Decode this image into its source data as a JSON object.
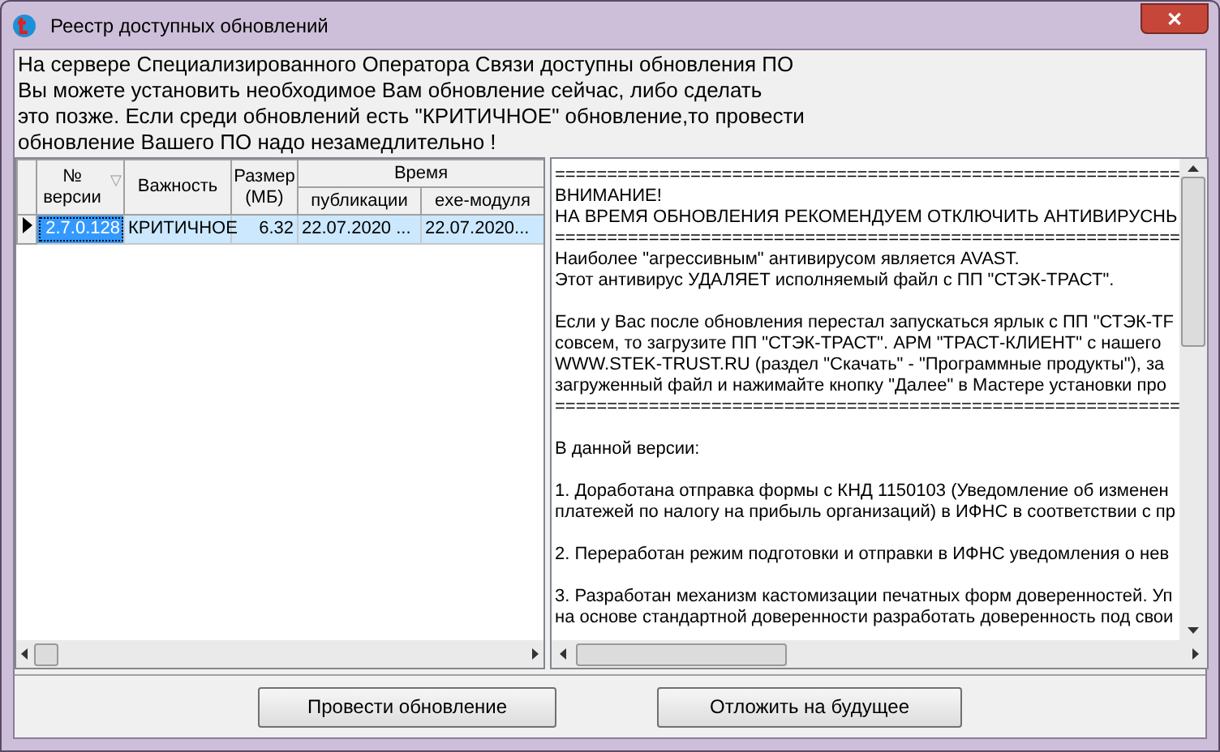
{
  "window": {
    "title": "Реестр доступных обновлений",
    "close_label": "✕"
  },
  "intro_lines": [
    "На сервере Специализированного Оператора Связи доступны обновления ПО",
    "Вы можете установить необходимое Вам обновление сейчас, либо сделать",
    "это позже. Если среди обновлений есть \"КРИТИЧНОЕ\"  обновление,то провести",
    "обновление Вашего ПО надо незамедлительно !"
  ],
  "table": {
    "header_rows": [
      [
        {
          "label": "№ версии",
          "sort_mark": "▽",
          "spans_both_rows": true
        },
        {
          "label": "Важность",
          "spans_both_rows": true
        },
        {
          "label": "Размер (МБ)",
          "spans_both_rows": true
        },
        {
          "label": "Время",
          "spans_two_columns": true
        }
      ],
      [
        {
          "label": "публикации"
        },
        {
          "label": "exe-модуля"
        }
      ]
    ],
    "rows": [
      {
        "selected": true,
        "cells": [
          "2.7.0.128",
          "КРИТИЧНОЕ",
          "6.32",
          "22.07.2020 ...",
          "22.07.2020..."
        ]
      }
    ]
  },
  "notes": [
    [
      "============================================================",
      "ВНИМАНИЕ!",
      "НА ВРЕМЯ ОБНОВЛЕНИЯ РЕКОМЕНДУЕМ ОТКЛЮЧИТЬ АНТИВИРУСНЬ",
      "============================================================",
      "Наиболее \"агрессивным\" антивирусом является AVAST.",
      "Этот антивирус УДАЛЯЕТ исполняемый файл с ПП \"СТЭК-ТРАСТ\"."
    ],
    [
      "Если у Вас после обновления перестал запускаться ярлык с ПП \"СТЭК-ТF",
      "совсем, то загрузите ПП \"СТЭК-ТРАСТ\". АРМ \"ТРАСТ-КЛИЕНТ\" с нашего",
      "WWW.STEK-TRUST.RU (раздел \"Скачать\" - \"Программные продукты\"), за",
      "загруженный файл и нажимайте кнопку \"Далее\" в Мастере установки про",
      "============================================================"
    ],
    [
      "В данной версии:"
    ],
    [
      "1. Доработана отправка формы с КНД 1150103 (Уведомление об изменен",
      "платежей по налогу на прибыль организаций) в ИФНС в соответствии с пр"
    ],
    [
      "2. Переработан режим подготовки и отправки в ИФНС уведомления о нев"
    ],
    [
      "3. Разработан механизм кастомизации печатных форм доверенностей. Уп",
      "на основе стандартной доверенности разработать доверенность под свои"
    ]
  ],
  "buttons": [
    "Провести обновление",
    "Отложить на будущее"
  ]
}
